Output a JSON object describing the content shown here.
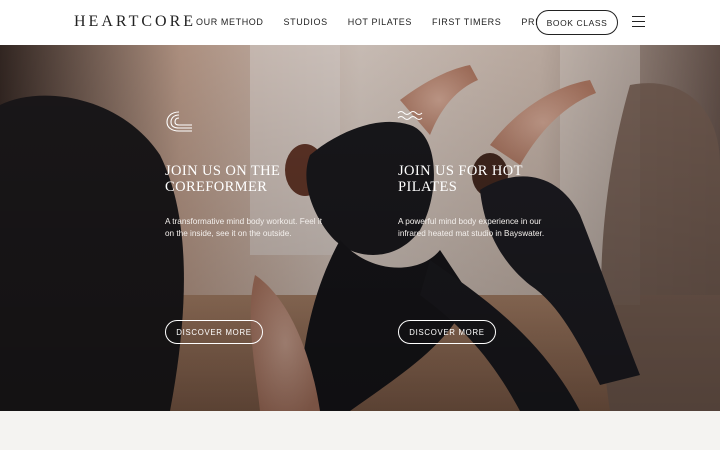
{
  "brand": {
    "logo": "HEARTCORE"
  },
  "nav": {
    "items": [
      "OUR METHOD",
      "STUDIOS",
      "HOT PILATES",
      "FIRST TIMERS",
      "PRICING"
    ],
    "book_label": "BOOK CLASS"
  },
  "panels": [
    {
      "title": "JOIN US ON THE COREFORMER",
      "description": "A transformative mind body workout. Feel it on the inside, see it on the outside.",
      "button": "DISCOVER MORE",
      "icon": "coreformer-icon"
    },
    {
      "title": "JOIN US FOR HOT PILATES",
      "description": "A powerful mind body experience in our infrared heated mat studio in Bayswater.",
      "button": "DISCOVER MORE",
      "icon": "waves-icon"
    }
  ],
  "colors": {
    "header_bg": "#ffffff",
    "text_dark": "#222222",
    "footer_bg": "#f4f3f1"
  }
}
